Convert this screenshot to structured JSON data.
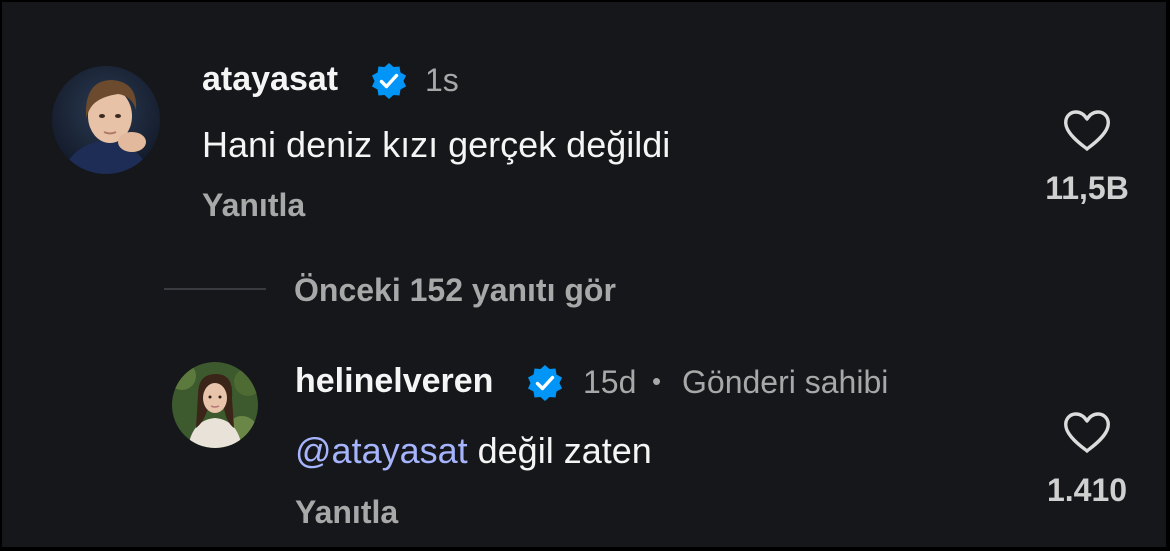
{
  "comments": [
    {
      "username": "atayasat",
      "time": "1s",
      "text": "Hani deniz kızı gerçek değildi",
      "reply_label": "Yanıtla",
      "likes": "11,5B",
      "verified": true
    },
    {
      "username": "helinelveren",
      "time": "15d",
      "separator": "•",
      "author_badge": "Gönderi sahibi",
      "mention": "@atayasat",
      "text": " değil zaten",
      "reply_label": "Yanıtla",
      "likes": "1.410",
      "verified": true
    }
  ],
  "view_replies": "Önceki 152 yanıtı gör",
  "colors": {
    "background": "#16171b",
    "text": "#f5f5f5",
    "secondary": "#a8a8a8",
    "verified": "#0095f6",
    "mention": "#a5b4fc"
  },
  "icons": {
    "like": "heart-outline-icon",
    "verified": "verified-badge-icon"
  }
}
